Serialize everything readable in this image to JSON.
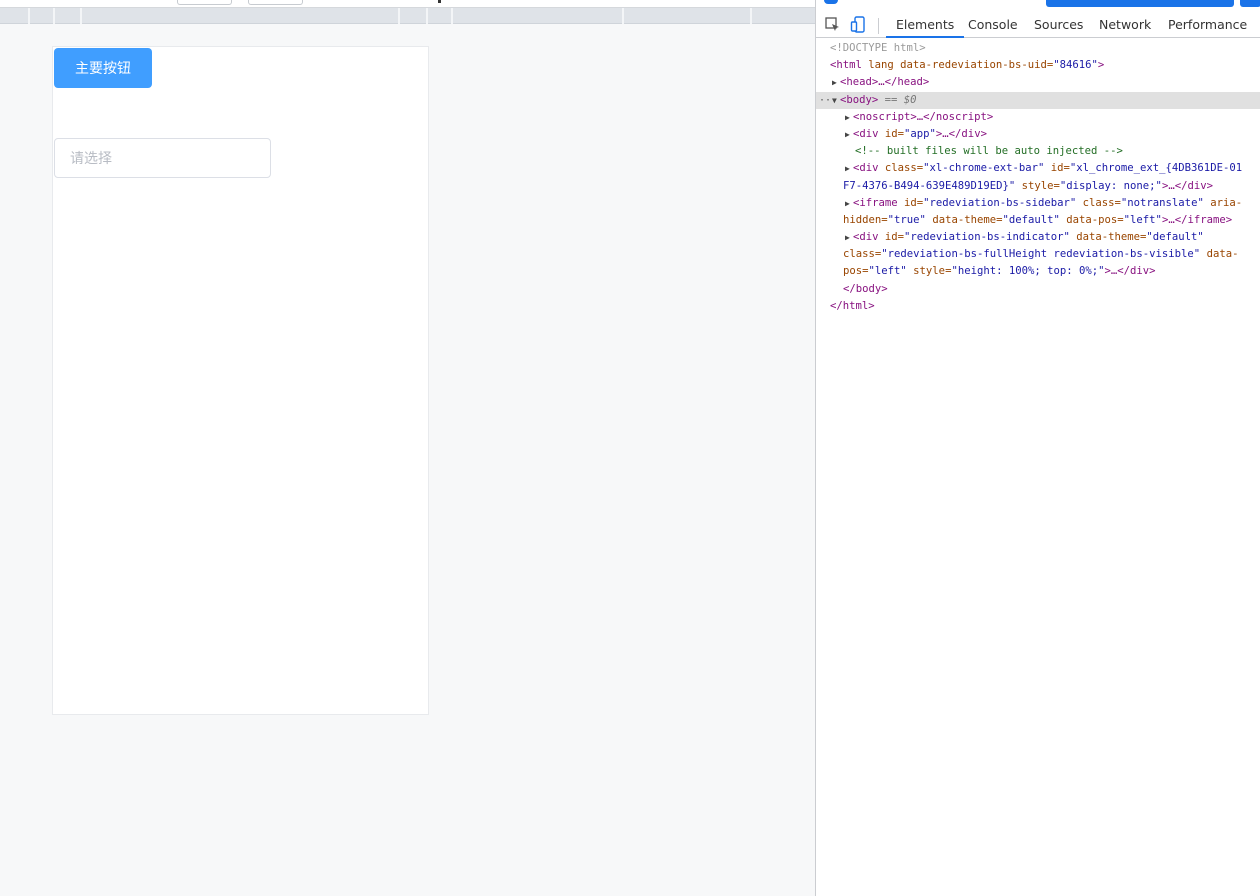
{
  "viewport": {
    "primary_button": "主要按钮",
    "select_placeholder": "请选择"
  },
  "devtools": {
    "tabs": [
      "Elements",
      "Console",
      "Sources",
      "Network",
      "Performance"
    ],
    "active_tab": "Elements",
    "tree": {
      "doctype": "<!DOCTYPE html>",
      "html_open": {
        "tag": "<html",
        "attrs": " lang data-redeviation-bs-uid=",
        "val": "\"84616\"",
        "close": ">"
      },
      "head": "<head>…</head>",
      "body_open": "<body>",
      "body_eq": "== $0",
      "noscript": "<noscript>…</noscript>",
      "app_div": {
        "pre": "<div ",
        "attr": "id=",
        "val": "\"app\"",
        "post": ">…</div>"
      },
      "comment": "<!-- built files will be auto injected -->",
      "ext_div": {
        "l1_pre": "<div ",
        "l1_attr1": "class=",
        "l1_val1": "\"xl-chrome-ext-bar\"",
        "l1_attr2": " id=",
        "l1_val2": "\"xl_chrome_ext_{4DB361DE-01",
        "l2_val": "F7-4376-B494-639E489D19ED}\"",
        "l2_attr": " style=",
        "l2_val2": "\"display: none;\"",
        "l2_post": ">…</div>"
      },
      "iframe": {
        "l1_pre": "<iframe ",
        "l1_attr1": "id=",
        "l1_val1": "\"redeviation-bs-sidebar\"",
        "l1_attr2": " class=",
        "l1_val2": "\"notranslate\"",
        "l1_attr3": " aria-",
        "l2_attr1": "hidden=",
        "l2_val1": "\"true\"",
        "l2_attr2": " data-theme=",
        "l2_val2": "\"default\"",
        "l2_attr3": " data-pos=",
        "l2_val3": "\"left\"",
        "l2_post": ">…</iframe>"
      },
      "indicator": {
        "l1_pre": "<div ",
        "l1_attr1": "id=",
        "l1_val1": "\"redeviation-bs-indicator\"",
        "l1_attr2": " data-theme=",
        "l1_val2": "\"default\"",
        "l2_attr": "class=",
        "l2_val": "\"redeviation-bs-fullHeight redeviation-bs-visible\"",
        "l2_attr2": " data-",
        "l3_attr": "pos=",
        "l3_val": "\"left\"",
        "l3_attr2": " style=",
        "l3_val2": "\"height: 100%; top: 0%;\"",
        "l3_post": ">…</div>"
      },
      "body_close": "</body>",
      "html_close": "</html>"
    }
  }
}
